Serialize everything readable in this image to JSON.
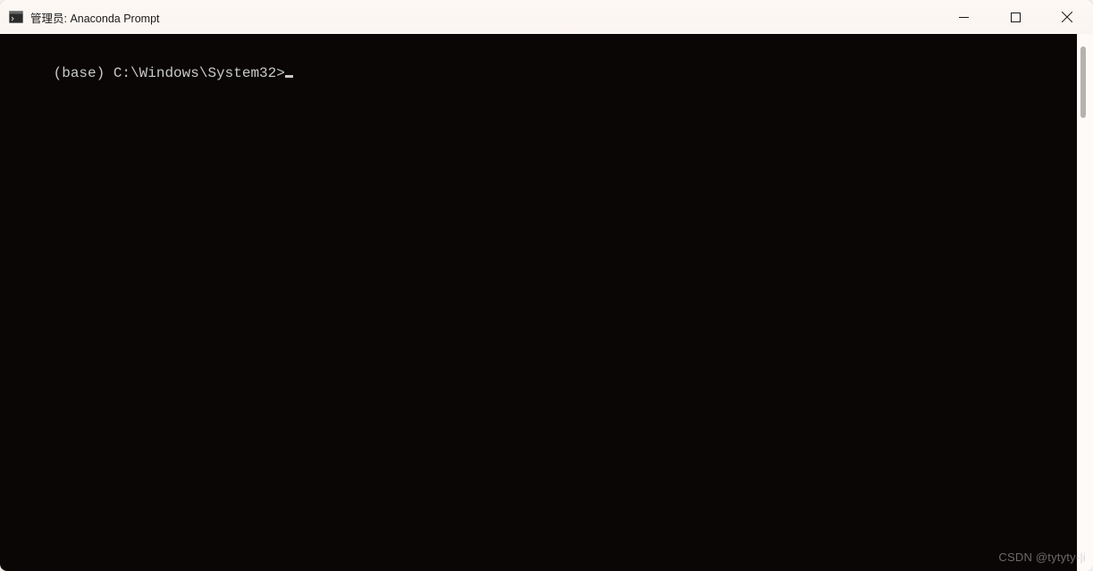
{
  "titlebar": {
    "title": "管理员: Anaconda Prompt"
  },
  "terminal": {
    "prompt_env": "(base)",
    "prompt_path": "C:\\Windows\\System32>",
    "input_value": ""
  },
  "watermark": {
    "text": "CSDN @tytyty-|i"
  },
  "icons": {
    "app": "terminal-icon",
    "minimize": "minimize-icon",
    "maximize": "maximize-icon",
    "close": "close-icon"
  }
}
